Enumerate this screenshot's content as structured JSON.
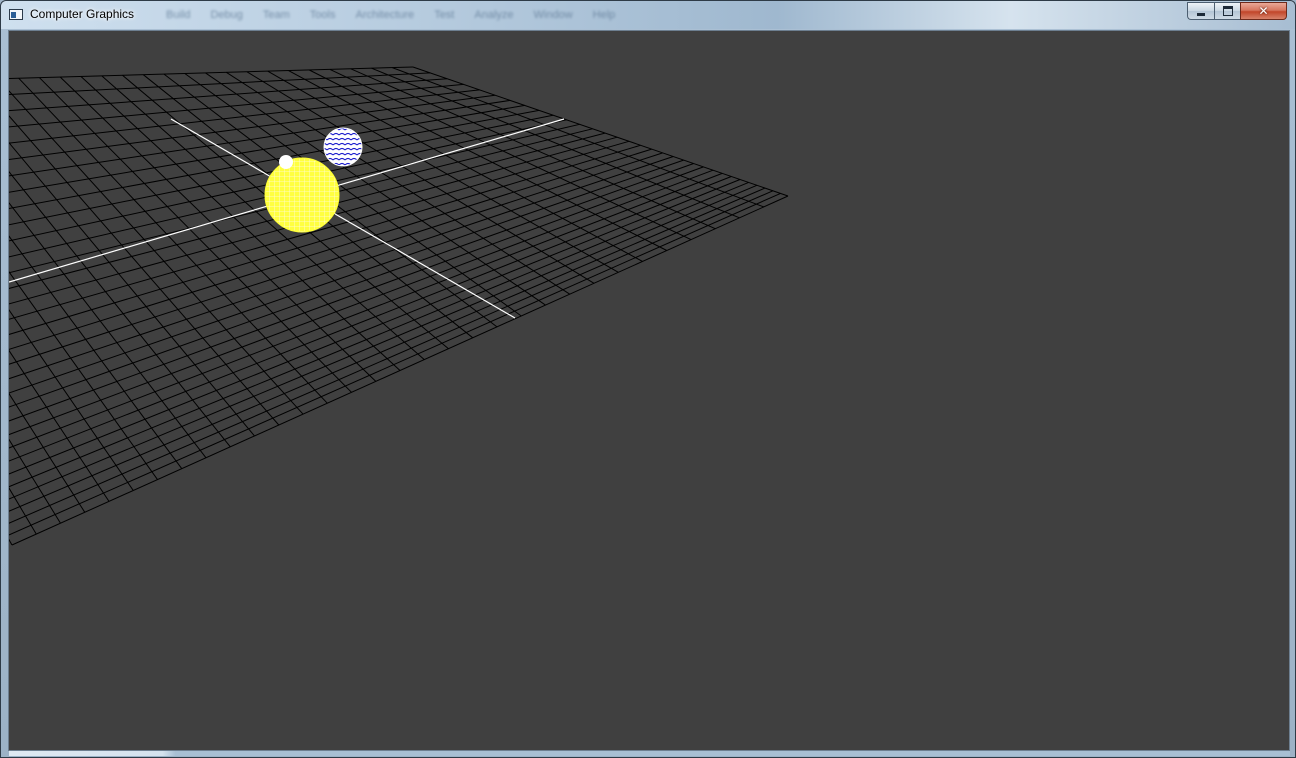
{
  "window": {
    "title": "Computer Graphics",
    "background_menu_items": [
      "Build",
      "Debug",
      "Team",
      "Tools",
      "Architecture",
      "Test",
      "Analyze",
      "Window",
      "Help"
    ],
    "controls": {
      "minimize_icon": "minimize-icon",
      "maximize_icon": "maximize-icon",
      "close_icon": "close-icon",
      "close_glyph": "✕"
    }
  },
  "viewport": {
    "background_color": "#404040",
    "grid_line_color": "#000000",
    "axis_line_color": "#ffffff",
    "objects": [
      {
        "name": "sun-sphere",
        "color": "#ffff33",
        "style": "wireframe"
      },
      {
        "name": "planet-sphere",
        "color": "#ffffff",
        "pattern_color": "#1a1acc",
        "style": "wireframe"
      },
      {
        "name": "moon-sphere",
        "color": "#ffffff",
        "style": "solid"
      }
    ]
  }
}
